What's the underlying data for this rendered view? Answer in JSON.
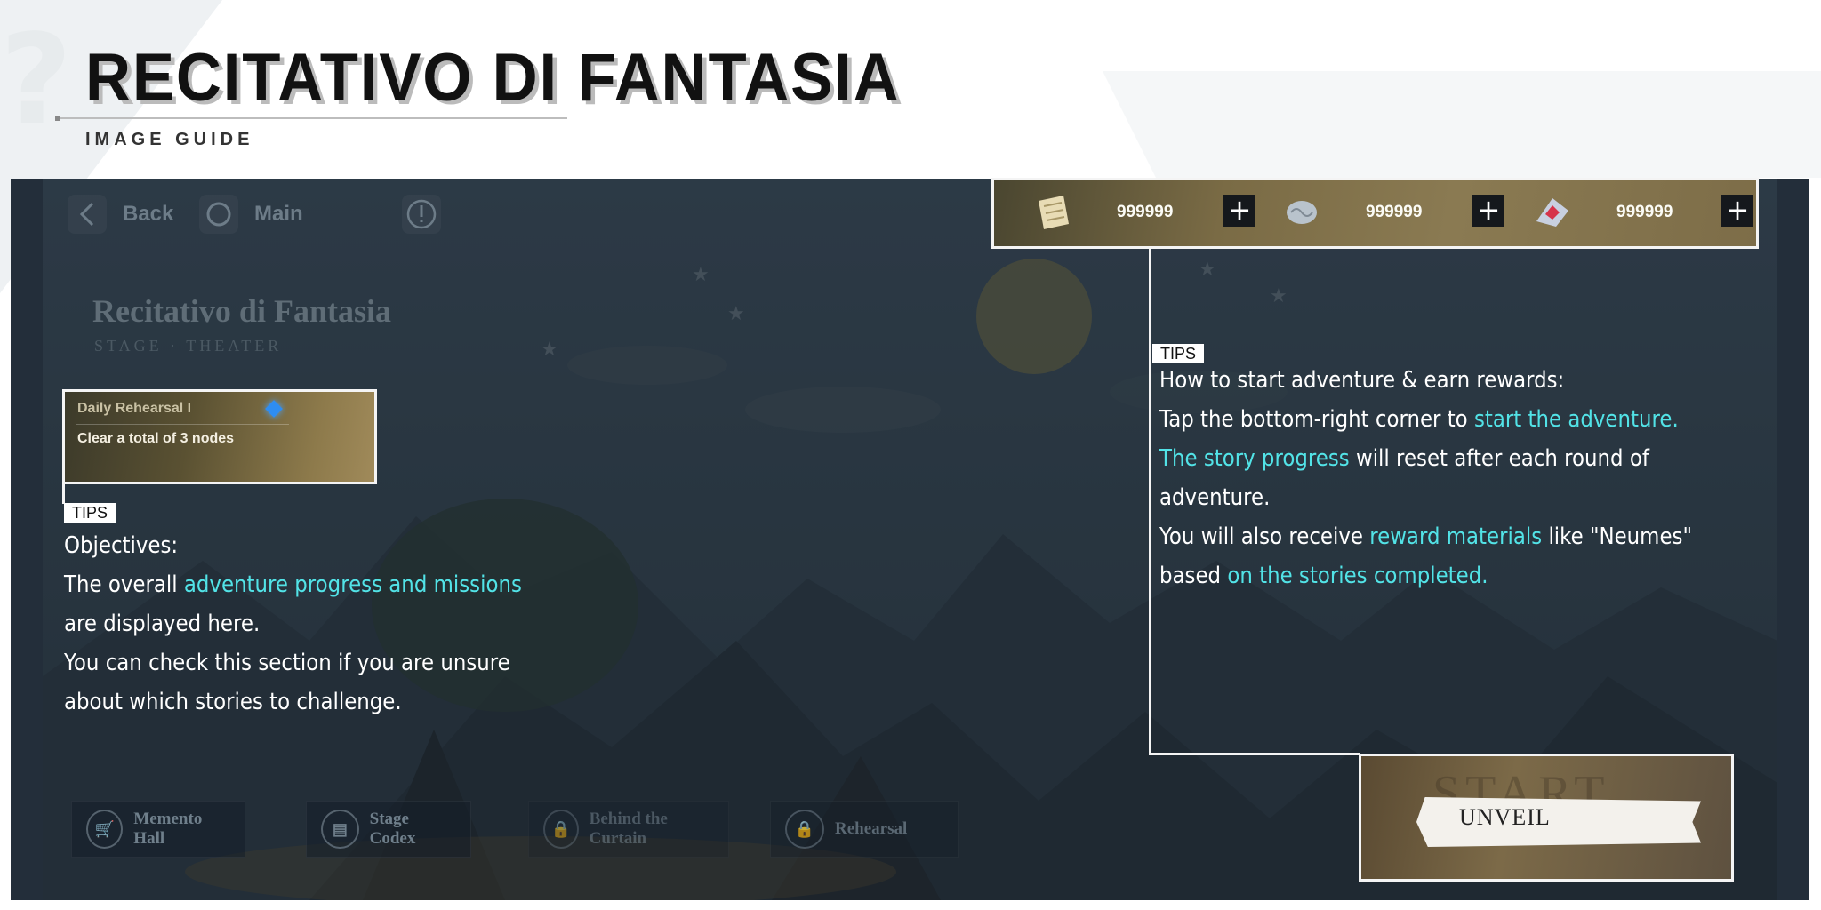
{
  "header": {
    "title": "RECITATIVO DI FANTASIA",
    "subtitle": "IMAGE GUIDE"
  },
  "game": {
    "nav": {
      "back_label": "Back",
      "main_label": "Main"
    },
    "stage_title": "Recitativo di Fantasia",
    "stage_subtitle": "STAGE · THEATER",
    "daily": {
      "title": "Daily Rehearsal I",
      "objective": "Clear a total of 3 nodes"
    },
    "resources": [
      {
        "icon": "scroll-icon",
        "value": "999999"
      },
      {
        "icon": "brain-icon",
        "value": "999999"
      },
      {
        "icon": "neume-crystal-icon",
        "value": "999999"
      }
    ],
    "bottom_buttons": [
      {
        "label": "Memento Hall"
      },
      {
        "label": "Stage Codex"
      },
      {
        "label": "Behind the Curtain"
      },
      {
        "label": "Rehearsal"
      }
    ],
    "start": {
      "ghost": "START",
      "label": "UNVEIL"
    }
  },
  "tips_left": {
    "badge": "TIPS",
    "line1": "Objectives:",
    "line2_pre": "The overall ",
    "line2_hi": "adventure progress and missions",
    "line3": "are displayed here.",
    "line4": "You can check this section if you are unsure",
    "line5": "about which stories to challenge."
  },
  "tips_right": {
    "badge": "TIPS",
    "line1": "How to start adventure & earn rewards:",
    "line2_pre": "Tap the bottom-right corner to ",
    "line2_hi": "start the adventure.",
    "line3_hi": "The story progress",
    "line3_post": " will reset after each round of",
    "line4": "adventure.",
    "line5_pre": "You will also receive ",
    "line5_hi": "reward materials",
    "line5_post": " like \"Neumes\"",
    "line6_pre": "based ",
    "line6_hi": "on the stories completed."
  },
  "colors": {
    "highlight": "#52e3e7",
    "panel": "#232e3a",
    "box_border": "#f4f4f4"
  }
}
